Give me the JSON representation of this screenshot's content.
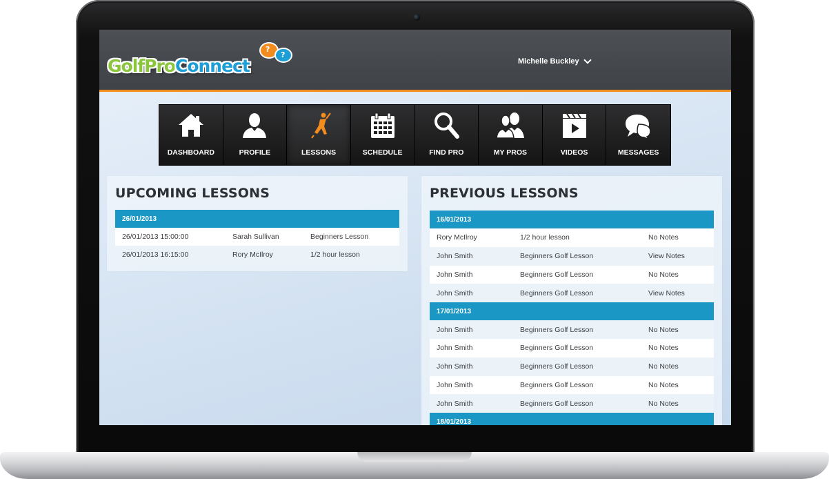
{
  "brand": {
    "logo_part1": "GolfPro",
    "logo_part2": "Connect",
    "colors": {
      "green": "#8cc63f",
      "blue": "#1d9fd6",
      "orange": "#f28c1e",
      "table_header": "#1a97c4"
    }
  },
  "user": {
    "name": "Michelle Buckley"
  },
  "nav": [
    {
      "label": "DASHBOARD",
      "icon": "home-icon",
      "active": false
    },
    {
      "label": "PROFILE",
      "icon": "person-icon",
      "active": false
    },
    {
      "label": "LESSONS",
      "icon": "golfer-icon",
      "active": true
    },
    {
      "label": "SCHEDULE",
      "icon": "calendar-icon",
      "active": false
    },
    {
      "label": "FIND PRO",
      "icon": "search-icon",
      "active": false
    },
    {
      "label": "MY PROS",
      "icon": "people-icon",
      "active": false
    },
    {
      "label": "VIDEOS",
      "icon": "video-icon",
      "active": false
    },
    {
      "label": "MESSAGES",
      "icon": "chat-icon",
      "active": false
    }
  ],
  "upcoming": {
    "title": "UPCOMING LESSONS",
    "groups": [
      {
        "date": "26/01/2013",
        "rows": [
          {
            "datetime": "26/01/2013 15:00:00",
            "name": "Sarah Sullivan",
            "lesson": "Beginners Lesson"
          },
          {
            "datetime": "26/01/2013 16:15:00",
            "name": "Rory McIlroy",
            "lesson": "1/2 hour lesson"
          }
        ]
      }
    ]
  },
  "previous": {
    "title": "PREVIOUS LESSONS",
    "groups": [
      {
        "date": "16/01/2013",
        "rows": [
          {
            "name": "Rory McIlroy",
            "lesson": "1/2 hour lesson",
            "notes": "No Notes",
            "notes_link": false
          },
          {
            "name": "John Smith",
            "lesson": "Beginners Golf Lesson",
            "notes": "View Notes",
            "notes_link": true
          },
          {
            "name": "John Smith",
            "lesson": "Beginners Golf Lesson",
            "notes": "No Notes",
            "notes_link": false
          },
          {
            "name": "John Smith",
            "lesson": "Beginners Golf Lesson",
            "notes": "View Notes",
            "notes_link": true
          }
        ]
      },
      {
        "date": "17/01/2013",
        "rows": [
          {
            "name": "John Smith",
            "lesson": "Beginners Golf Lesson",
            "notes": "No Notes",
            "notes_link": false
          },
          {
            "name": "John Smith",
            "lesson": "Beginners Golf Lesson",
            "notes": "No Notes",
            "notes_link": false
          },
          {
            "name": "John Smith",
            "lesson": "Beginners Golf Lesson",
            "notes": "No Notes",
            "notes_link": false
          },
          {
            "name": "John Smith",
            "lesson": "Beginners Golf Lesson",
            "notes": "No Notes",
            "notes_link": false
          },
          {
            "name": "John Smith",
            "lesson": "Beginners Golf Lesson",
            "notes": "No Notes",
            "notes_link": false
          }
        ]
      },
      {
        "date": "18/01/2013",
        "rows": []
      }
    ]
  }
}
